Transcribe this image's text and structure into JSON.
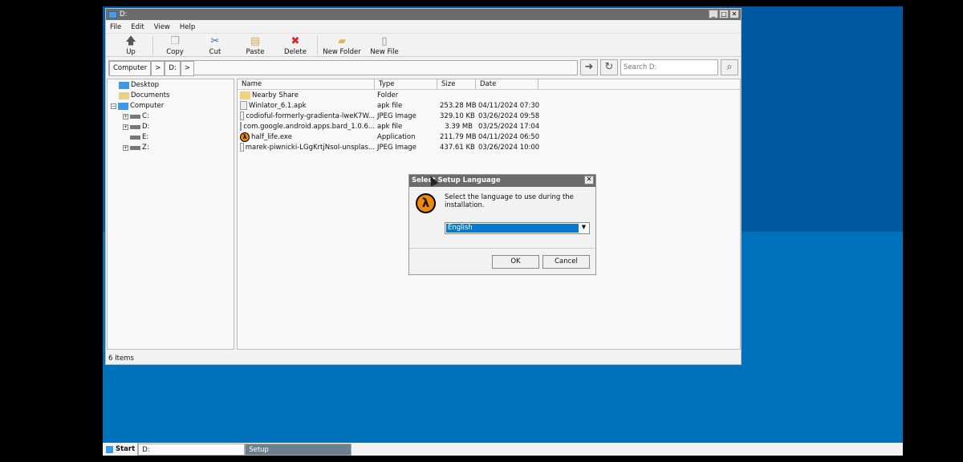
{
  "window": {
    "title": "D:",
    "menu": [
      "File",
      "Edit",
      "View",
      "Help"
    ],
    "toolbar": [
      "Up",
      "Copy",
      "Cut",
      "Paste",
      "Delete",
      "New Folder",
      "New File"
    ],
    "breadcrumb": [
      "Computer",
      "D:"
    ],
    "search_placeholder": "Search D:",
    "tree": [
      "Desktop",
      "Documents",
      "Computer",
      "C:",
      "D:",
      "E:",
      "Z:"
    ],
    "columns": [
      "Name",
      "Type",
      "Size",
      "Date"
    ],
    "files": [
      {
        "name": "Nearby Share",
        "type": "Folder",
        "size": "",
        "date": "",
        "icon": "folder"
      },
      {
        "name": "Winlator_6.1.apk",
        "type": "apk file",
        "size": "253.28 MB",
        "date": "04/11/2024 07:30",
        "icon": "file"
      },
      {
        "name": "codioful-formerly-gradienta-lweK7W...",
        "type": "JPEG Image",
        "size": "329.10 KB",
        "date": "03/26/2024 09:58",
        "icon": "file"
      },
      {
        "name": "com.google.android.apps.bard_1.0.6...",
        "type": "apk file",
        "size": "3.39 MB",
        "date": "03/25/2024 17:04",
        "icon": "file"
      },
      {
        "name": "half_life.exe",
        "type": "Application",
        "size": "211.79 MB",
        "date": "04/11/2024 06:50",
        "icon": "half-life"
      },
      {
        "name": "marek-piwnicki-LGgKrtjNsoI-unsplas...",
        "type": "JPEG Image",
        "size": "437.61 KB",
        "date": "03/26/2024 10:00",
        "icon": "file"
      }
    ],
    "status": "6 Items"
  },
  "dialog": {
    "title": "Select Setup Language",
    "message": "Select the language to use during the installation.",
    "language": "English",
    "ok": "OK",
    "cancel": "Cancel"
  },
  "taskbar": {
    "start": "Start",
    "items": [
      "D:",
      "Setup"
    ]
  }
}
